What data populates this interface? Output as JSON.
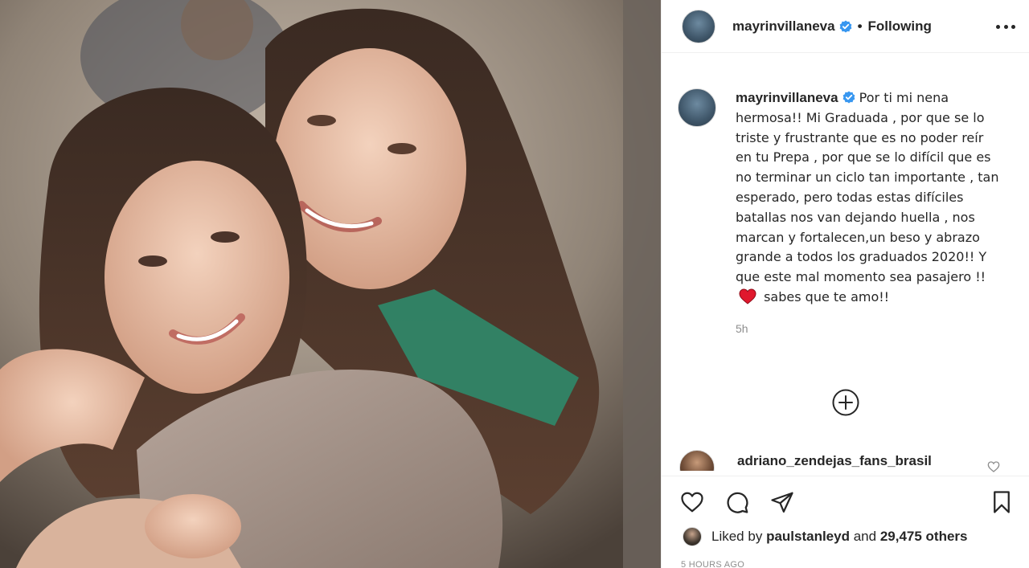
{
  "photo": {
    "alt": ""
  },
  "header": {
    "username": "mayrinvillaneva",
    "separator": "•",
    "follow_status": "Following",
    "more_icon": "more-horizontal-icon"
  },
  "caption": {
    "username": "mayrinvillaneva",
    "text_before_emoji": "Por ti mi nena hermosa!! Mi Graduada , por que se lo triste y frustrante que es no poder reír en tu Prepa , por que se lo difícil que es no terminar un ciclo tan importante , tan esperado, pero todas estas difíciles batallas nos van dejando huella , nos marcan y fortalecen,un beso y abrazo grande a todos los graduados 2020!! Y que este mal momento sea pasajero !!",
    "emoji": "red-heart-emoji",
    "text_after_emoji": "sabes que te amo!!",
    "time": "5h"
  },
  "load_more_icon": "plus-circle-icon",
  "comment": {
    "username": "adriano_zendejas_fans_brasil"
  },
  "actions": {
    "like_icon": "heart-icon",
    "comment_icon": "comment-icon",
    "share_icon": "paper-plane-icon",
    "save_icon": "bookmark-icon"
  },
  "likes": {
    "prefix": "Liked by",
    "user": "paulstanleyd",
    "middle": "and",
    "count": "29,475 others"
  },
  "posted": "5 HOURS AGO",
  "colors": {
    "verified": "#3897f0",
    "text": "#262626",
    "muted": "#8e8e8e",
    "heart_emoji": "#e0182d"
  }
}
